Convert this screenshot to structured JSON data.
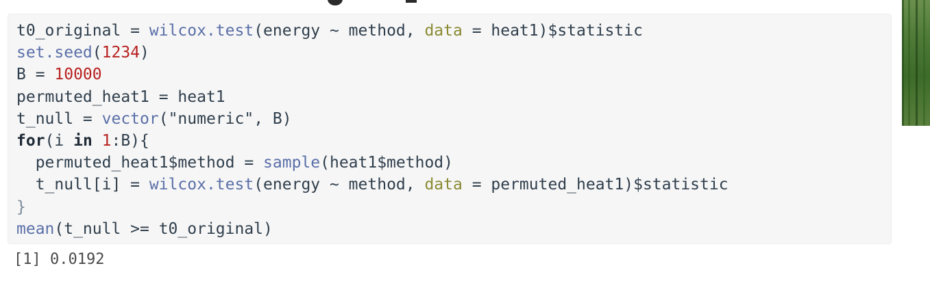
{
  "code": {
    "lines": [
      [
        {
          "t": "t0_original = ",
          "c": "plain"
        },
        {
          "t": "wilcox.test",
          "c": "fn"
        },
        {
          "t": "(energy ~ method, ",
          "c": "plain"
        },
        {
          "t": "data",
          "c": "arg"
        },
        {
          "t": " = heat1)$statistic",
          "c": "plain"
        }
      ],
      [
        {
          "t": "set.seed",
          "c": "fn"
        },
        {
          "t": "(",
          "c": "plain"
        },
        {
          "t": "1234",
          "c": "num"
        },
        {
          "t": ")",
          "c": "plain"
        }
      ],
      [
        {
          "t": "B = ",
          "c": "plain"
        },
        {
          "t": "10000",
          "c": "num"
        }
      ],
      [
        {
          "t": "permuted_heat1 = heat1",
          "c": "plain"
        }
      ],
      [
        {
          "t": "t_null = ",
          "c": "plain"
        },
        {
          "t": "vector",
          "c": "fn"
        },
        {
          "t": "(\"numeric\", B)",
          "c": "plain"
        }
      ],
      [
        {
          "t": "for",
          "c": "kw"
        },
        {
          "t": "(i ",
          "c": "plain"
        },
        {
          "t": "in",
          "c": "kw"
        },
        {
          "t": " ",
          "c": "plain"
        },
        {
          "t": "1",
          "c": "num"
        },
        {
          "t": ":B){",
          "c": "plain"
        }
      ],
      [
        {
          "t": "  permuted_heat1$method = ",
          "c": "plain"
        },
        {
          "t": "sample",
          "c": "fn"
        },
        {
          "t": "(heat1$method)",
          "c": "plain"
        }
      ],
      [
        {
          "t": "  t_null[i] = ",
          "c": "plain"
        },
        {
          "t": "wilcox.test",
          "c": "fn"
        },
        {
          "t": "(energy ~ method, ",
          "c": "plain"
        },
        {
          "t": "data",
          "c": "arg"
        },
        {
          "t": " = permuted_heat1)$statistic",
          "c": "plain"
        }
      ],
      [
        {
          "t": "}",
          "c": "brace"
        }
      ],
      [
        {
          "t": "mean",
          "c": "fn"
        },
        {
          "t": "(t_null >= t0_original)",
          "c": "plain"
        }
      ]
    ]
  },
  "output": {
    "text": "[1] 0.0192"
  },
  "colors": {
    "code_background": "#f6f6f6",
    "function": "#5a6fa8",
    "argument_name": "#8a8a33",
    "number": "#b7211f",
    "plain_text": "#2f3e4c"
  }
}
